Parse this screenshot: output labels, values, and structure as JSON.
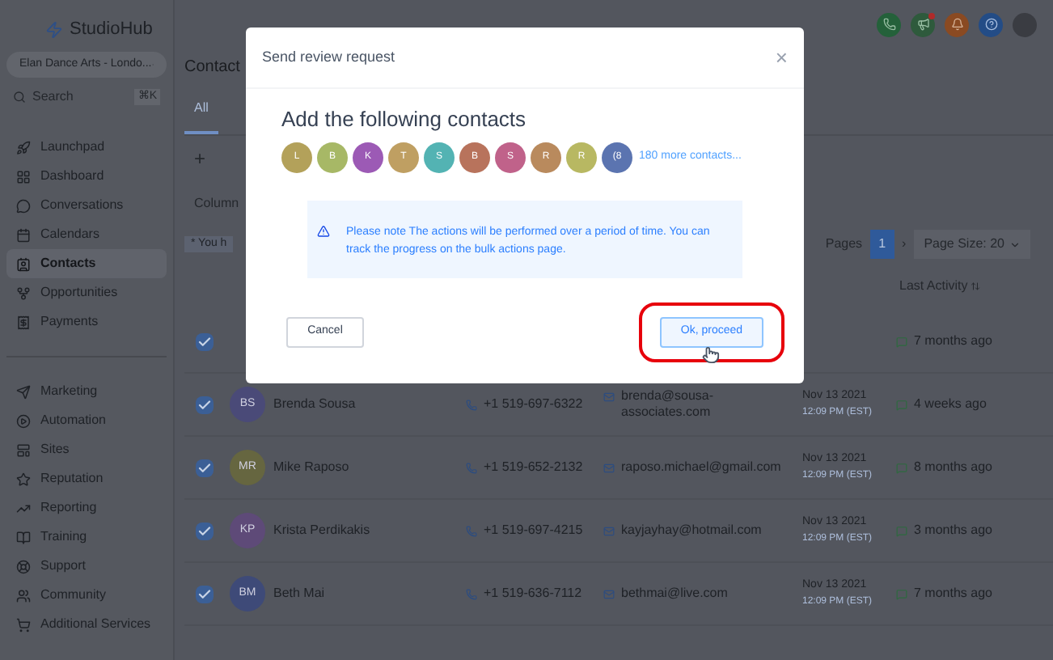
{
  "sidebar": {
    "logo": "StudioHub",
    "account": "Elan Dance Arts - Londo...",
    "search": {
      "placeholder": "Search",
      "shortcut": "⌘K"
    },
    "items": [
      {
        "label": "Launchpad",
        "selected": false
      },
      {
        "label": "Dashboard",
        "selected": false
      },
      {
        "label": "Conversations",
        "selected": false
      },
      {
        "label": "Calendars",
        "selected": false
      },
      {
        "label": "Contacts",
        "selected": true
      },
      {
        "label": "Opportunities",
        "selected": false
      },
      {
        "label": "Payments",
        "selected": false
      }
    ],
    "items_2": [
      {
        "label": "Marketing",
        "selected": false
      },
      {
        "label": "Automation",
        "selected": false
      },
      {
        "label": "Sites",
        "selected": false
      },
      {
        "label": "Reputation",
        "selected": false
      },
      {
        "label": "Reporting",
        "selected": false
      },
      {
        "label": "Training",
        "selected": false
      },
      {
        "label": "Support",
        "selected": false
      },
      {
        "label": "Community",
        "selected": false
      },
      {
        "label": "Additional Services",
        "selected": false
      }
    ]
  },
  "page": {
    "title": "Contact",
    "tabs": [
      {
        "label": "All",
        "selected": true
      }
    ],
    "add": "+",
    "columns": "Column",
    "notice": "* You h",
    "pagination": {
      "label": "Pages",
      "pages": [
        {
          "label": "1",
          "selected": true
        }
      ],
      "next": "›",
      "page_size": "Page Size: 20"
    },
    "table": {
      "columns": [
        "Last Activity"
      ],
      "rows": [
        {
          "checked": true,
          "last_activity": "7 months ago"
        },
        {
          "checked": true,
          "initials": "BS",
          "color": "#4a4a78",
          "name": "Brenda Sousa",
          "phone": "+1 519-697-6322",
          "email": "brenda@sousa-associates.com",
          "date": "Nov 13 2021",
          "time": "12:09 PM (EST)",
          "last_activity": "4 weeks ago"
        },
        {
          "checked": true,
          "initials": "MR",
          "color": "#666640",
          "name": "Mike Raposo",
          "phone": "+1 519-652-2132",
          "email": "raposo.michael@gmail.com",
          "date": "Nov 13 2021",
          "time": "12:09 PM (EST)",
          "last_activity": "8 months ago"
        },
        {
          "checked": true,
          "initials": "KP",
          "color": "#5e4a78",
          "name": "Krista Perdikakis",
          "phone": "+1 519-697-4215",
          "email": "kayjayhay@hotmail.com",
          "date": "Nov 13 2021",
          "time": "12:09 PM (EST)",
          "last_activity": "3 months ago"
        },
        {
          "checked": true,
          "initials": "BM",
          "color": "#3e4a78",
          "name": "Beth Mai",
          "phone": "+1 519-636-7112",
          "email": "bethmai@live.com",
          "date": "Nov 13 2021",
          "time": "12:09 PM (EST)",
          "last_activity": "7 months ago"
        }
      ]
    }
  },
  "modal": {
    "title": "Send review request",
    "close": "×",
    "heading": "Add the following contacts",
    "contacts": [
      {
        "initial": "L",
        "color": "#b3a15a"
      },
      {
        "initial": "B",
        "color": "#a7b866"
      },
      {
        "initial": "K",
        "color": "#9c5ab5"
      },
      {
        "initial": "T",
        "color": "#bf9f62"
      },
      {
        "initial": "S",
        "color": "#53b3b3"
      },
      {
        "initial": "B",
        "color": "#b8735c"
      },
      {
        "initial": "S",
        "color": "#c0628a"
      },
      {
        "initial": "R",
        "color": "#b98a5d"
      },
      {
        "initial": "R",
        "color": "#b8b862"
      },
      {
        "initial": "(8",
        "color": "#5b74b0"
      }
    ],
    "more": "180 more contacts...",
    "notice": "Please note The actions will be performed over a period of time. You can track the progress on the bulk actions page.",
    "buttons": [
      {
        "label": "Cancel",
        "kind": "secondary",
        "highlighted": false
      },
      {
        "label": "Ok, proceed",
        "kind": "primary",
        "highlighted": true
      }
    ]
  }
}
